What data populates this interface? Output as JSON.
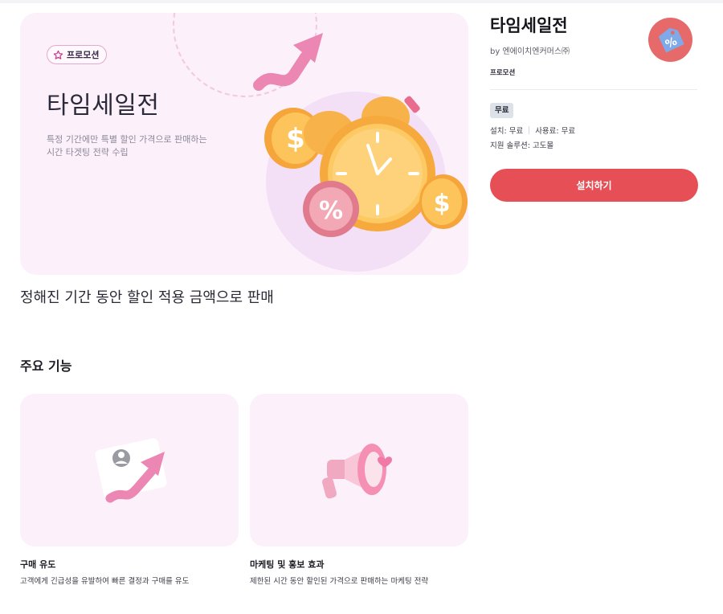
{
  "hero": {
    "badge_icon": "star-icon",
    "badge_label": "프로모션",
    "title": "타임세일전",
    "description_line1": "특정 기간에만 특별 할인 가격으로 판매하는",
    "description_line2": "시간 타겟팅 전략 수립",
    "illustration": "alarm-clock-coins-illustration"
  },
  "subtitle": "정해진 기간 동안 할인 적용 금액으로 판매",
  "features": {
    "section_title": "주요 기능",
    "items": [
      {
        "icon": "rising-arrow-profile-illustration",
        "title": "구매 유도",
        "description": "고객에게 긴급성을 유발하여 빠른 결정과 구매를 유도"
      },
      {
        "icon": "megaphone-illustration",
        "title": "마케팅 및 홍보 효과",
        "description": "제한된 시간 동안 할인된 가격으로 판매하는 마케팅 전략"
      }
    ]
  },
  "app": {
    "title": "타임세일전",
    "vendor": "by 엔에이치엔커머스㈜",
    "category": "프로모션",
    "icon": "discount-tag-icon",
    "price_badge": "무료",
    "install_fee": "설치: 무료",
    "usage_fee": "사용료: 무료",
    "support": "지원 솔루션: 고도몰",
    "install_button": "설치하기"
  },
  "colors": {
    "accent": "#e54f55",
    "hero_bg": "#fcf0fa",
    "badge_bg": "#dde1e8"
  }
}
